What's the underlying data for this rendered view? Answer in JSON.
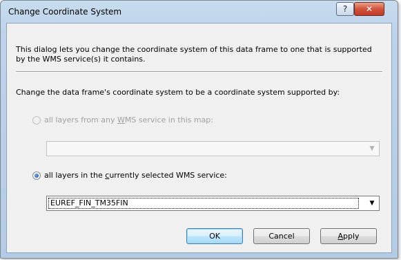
{
  "window": {
    "title": "Change Coordinate System",
    "help_label": "?",
    "close_label": "✕"
  },
  "description": "This dialog lets you change the coordinate system of this data frame to one that is supported by the WMS service(s) it contains.",
  "change_label": "Change the data frame's coordinate system to be a coordinate system supported by:",
  "options": {
    "all_layers_any": {
      "label_pre": "all layers from any ",
      "label_accel": "W",
      "label_post": "MS service in this map:",
      "checked": false,
      "enabled": false,
      "dropdown_value": ""
    },
    "selected_service": {
      "label_pre": "all layers in the ",
      "label_accel": "c",
      "label_post": "urrently selected WMS service:",
      "checked": true,
      "enabled": true,
      "dropdown_value": "EUREF_FIN_TM35FIN"
    }
  },
  "buttons": {
    "ok": "OK",
    "cancel": "Cancel",
    "apply_accel": "A",
    "apply_rest": "pply"
  },
  "icons": {
    "dropdown": "chevron-down-icon"
  }
}
